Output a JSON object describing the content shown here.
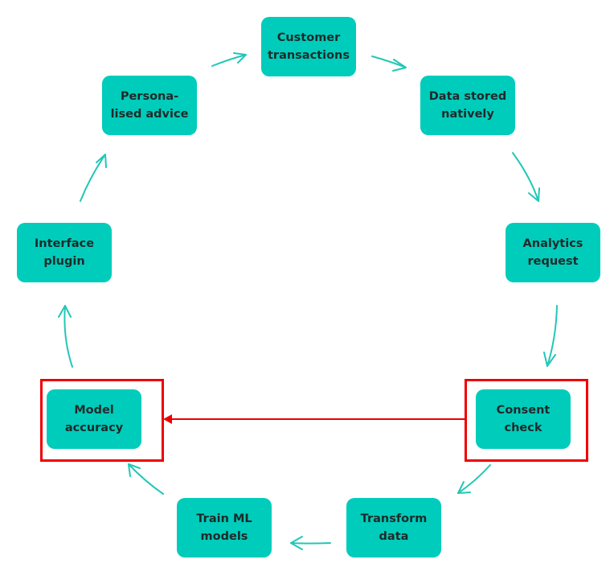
{
  "diagram": {
    "colors": {
      "node_fill": "#00CCBB",
      "arrow": "#22C7B8",
      "highlight": "#EE0000",
      "text": "#1F2A2A"
    },
    "nodes": [
      {
        "id": "customer-transactions",
        "label": "Customer transactions"
      },
      {
        "id": "data-stored-natively",
        "label": "Data stored natively"
      },
      {
        "id": "analytics-request",
        "label": "Analytics request"
      },
      {
        "id": "consent-check",
        "label": "Consent check",
        "highlighted": true
      },
      {
        "id": "transform-data",
        "label": "Transform data"
      },
      {
        "id": "train-ml-models",
        "label": "Train ML models"
      },
      {
        "id": "model-accuracy",
        "label": "Model accuracy",
        "highlighted": true
      },
      {
        "id": "interface-plugin",
        "label": "Interface plugin"
      },
      {
        "id": "personalised-advice",
        "label": "Persona-lised advice"
      }
    ],
    "cycle_edges": [
      [
        "customer-transactions",
        "data-stored-natively"
      ],
      [
        "data-stored-natively",
        "analytics-request"
      ],
      [
        "analytics-request",
        "consent-check"
      ],
      [
        "consent-check",
        "transform-data"
      ],
      [
        "transform-data",
        "train-ml-models"
      ],
      [
        "train-ml-models",
        "model-accuracy"
      ],
      [
        "model-accuracy",
        "interface-plugin"
      ],
      [
        "interface-plugin",
        "personalised-advice"
      ],
      [
        "personalised-advice",
        "customer-transactions"
      ]
    ],
    "highlight_edge": [
      "consent-check",
      "model-accuracy"
    ]
  }
}
